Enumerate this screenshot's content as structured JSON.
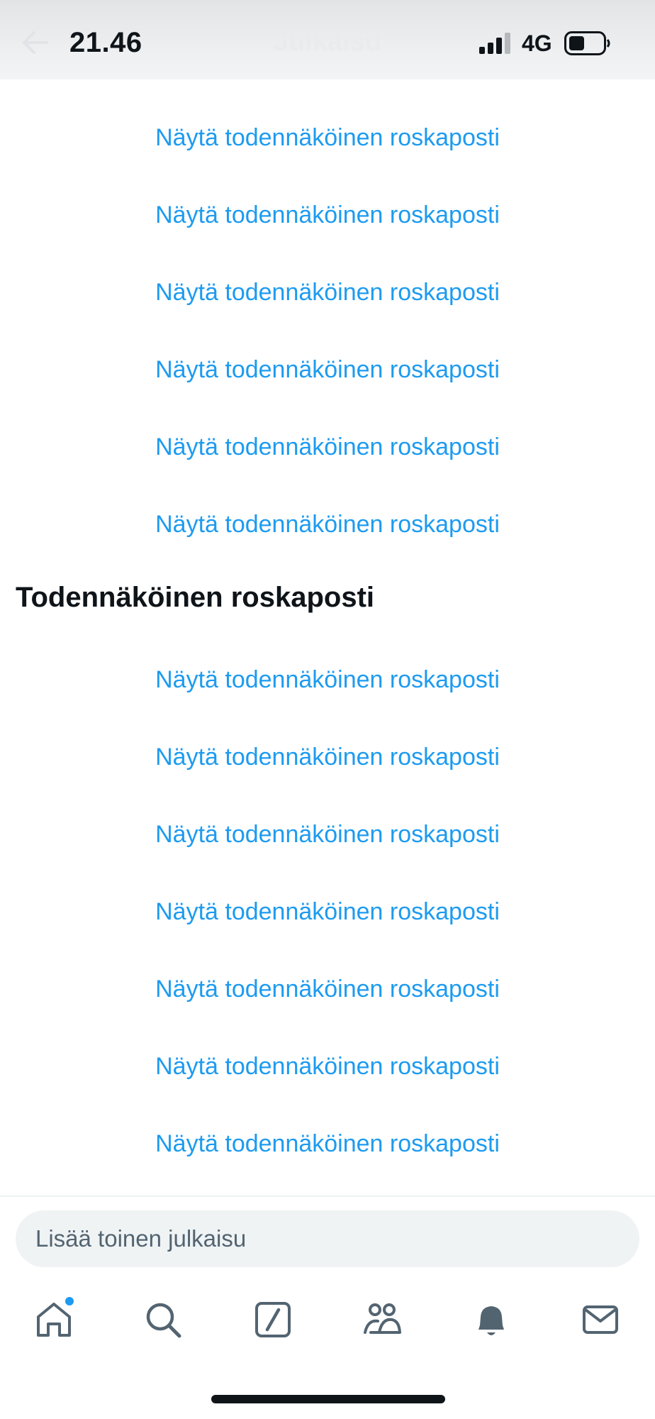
{
  "status_bar": {
    "time": "21.46",
    "network": "4G",
    "signal_icon": "signal-bars-icon",
    "battery_icon": "battery-icon"
  },
  "header": {
    "title": "Julkaisu",
    "back_icon": "back-arrow-icon"
  },
  "links_top": [
    "Näytä todennäköinen roskaposti",
    "Näytä todennäköinen roskaposti",
    "Näytä todennäköinen roskaposti",
    "Näytä todennäköinen roskaposti",
    "Näytä todennäköinen roskaposti",
    "Näytä todennäköinen roskaposti"
  ],
  "section_heading": "Todennäköinen roskaposti",
  "links_bottom": [
    "Näytä todennäköinen roskaposti",
    "Näytä todennäköinen roskaposti",
    "Näytä todennäköinen roskaposti",
    "Näytä todennäköinen roskaposti",
    "Näytä todennäköinen roskaposti",
    "Näytä todennäköinen roskaposti",
    "Näytä todennäköinen roskaposti"
  ],
  "reply": {
    "placeholder": "Lisää toinen julkaisu"
  },
  "nav": {
    "items": [
      "home-icon",
      "search-icon",
      "grok-icon",
      "communities-icon",
      "notifications-icon",
      "messages-icon"
    ],
    "unread_indicator_color": "#1d9bf0"
  },
  "colors": {
    "link": "#1d9bf0",
    "text": "#0f1419",
    "muted": "#536471"
  }
}
